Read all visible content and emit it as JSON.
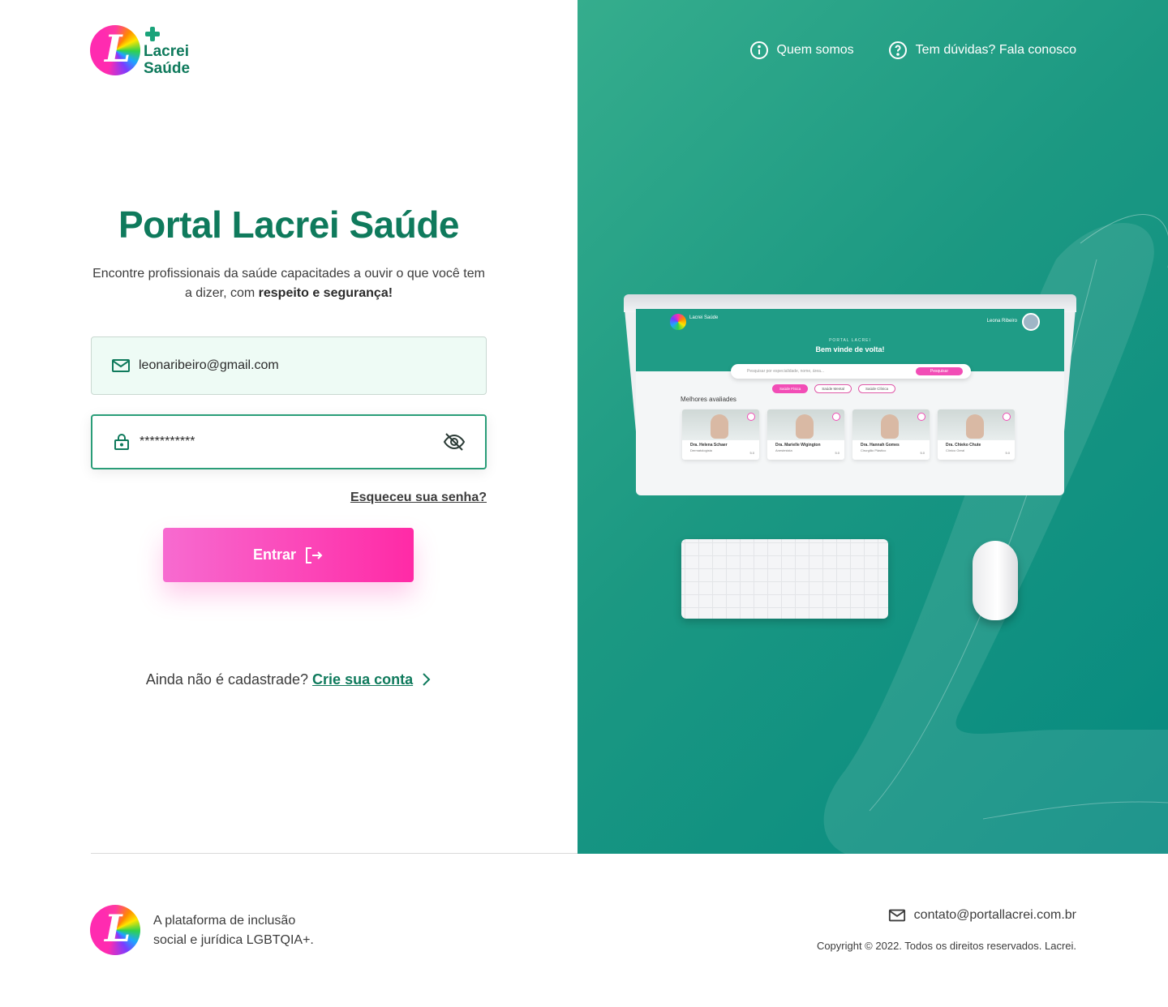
{
  "brand": {
    "line1": "Lacrei",
    "line2": "Saúde"
  },
  "nav": {
    "about": "Quem somos",
    "help": "Tem dúvidas? Fala conosco"
  },
  "login": {
    "title": "Portal Lacrei Saúde",
    "subtitle_plain": "Encontre profissionais da saúde capacitades a ouvir o que você tem a dizer, com ",
    "subtitle_bold": "respeito e segurança!",
    "email_value": "leonaribeiro@gmail.com",
    "password_value": "***********",
    "forgot": "Esqueceu sua senha?",
    "submit": "Entrar",
    "no_account": "Ainda não é cadastrade?",
    "create_account": "Crie sua conta"
  },
  "mockup": {
    "brand": "Lacrei Saúde",
    "user": "Leona Ribeiro",
    "portal": "PORTAL LACREI",
    "welcome": "Bem vinde de volta!",
    "search_placeholder": "Pesquisar por especialidade, nome, área...",
    "search_button": "Pesquisar",
    "chips": [
      "Saúde Física",
      "Saúde Mental",
      "Saúde Clínica"
    ],
    "best_rated": "Melhores avaliades",
    "doctors": [
      {
        "name": "Dra. Helena Schaer",
        "specialty": "Dermatologista",
        "rating": "5.0"
      },
      {
        "name": "Dra. Marielle Wigington",
        "specialty": "Anestesista",
        "rating": "5.0"
      },
      {
        "name": "Dra. Hannah Gomes",
        "specialty": "Cirurgião Plástico",
        "rating": "5.0"
      },
      {
        "name": "Dra. Chieko Chute",
        "specialty": "Clínico Geral",
        "rating": "5.0"
      }
    ]
  },
  "footer": {
    "tagline": "A plataforma de inclusão social e jurídica LGBTQIA+.",
    "email": "contato@portallacrei.com.br",
    "copyright": "Copyright © 2022. Todos os direitos reservados. Lacrei."
  },
  "colors": {
    "brand_green": "#0f7a5c",
    "accent_pink": "#ff2aa6",
    "hero_teal": "#1b9882"
  }
}
